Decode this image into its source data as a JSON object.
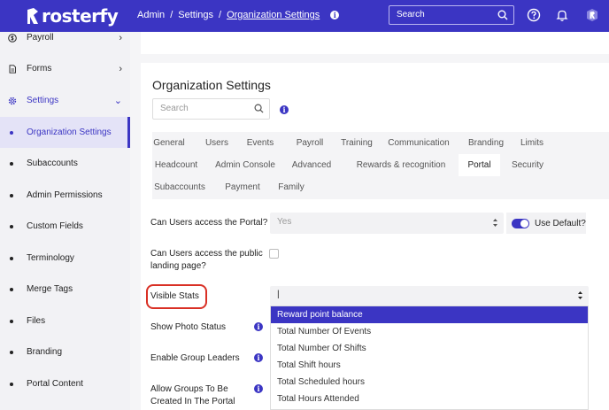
{
  "app": {
    "brand": "rosterfy"
  },
  "header": {
    "breadcrumbs": [
      "Admin",
      "Settings",
      "Organization Settings"
    ],
    "info_glyph": "i",
    "search_placeholder": "Search",
    "icons": [
      "help-circle-icon",
      "bell-icon",
      "user-avatar-icon"
    ]
  },
  "sidebar": {
    "items": [
      {
        "label": "Payroll",
        "icon": "dollar-circle-icon",
        "chevron": "›"
      },
      {
        "label": "Forms",
        "icon": "document-icon",
        "chevron": "›"
      },
      {
        "label": "Settings",
        "icon": "gear-icon",
        "chevron": "⌄"
      },
      {
        "label": "Organization Settings"
      },
      {
        "label": "Subaccounts"
      },
      {
        "label": "Admin Permissions"
      },
      {
        "label": "Custom Fields"
      },
      {
        "label": "Terminology"
      },
      {
        "label": "Merge Tags"
      },
      {
        "label": "Files"
      },
      {
        "label": "Branding"
      },
      {
        "label": "Portal Content"
      }
    ]
  },
  "main": {
    "title": "Organization Settings",
    "search_placeholder": "Search",
    "tabs": [
      "General",
      "Users",
      "Events",
      "Payroll",
      "Training",
      "Communication",
      "Branding",
      "Limits",
      "Headcount",
      "Admin Console",
      "Advanced",
      "Rewards & recognition",
      "Portal",
      "Security",
      "Subaccounts",
      "Payment",
      "Family"
    ],
    "active_tab": "Portal",
    "fields": {
      "portal_access": {
        "label": "Can Users access the Portal?",
        "value": "Yes",
        "use_default_label": "Use Default?",
        "use_default_on": true
      },
      "public_landing": {
        "label_line1": "Can Users access the public",
        "label_line2": "landing page?",
        "checked": false
      },
      "visible_stats": {
        "label": "Visible Stats",
        "value": "|"
      },
      "show_photo": {
        "label": "Show Photo Status"
      },
      "group_leaders": {
        "label": "Enable Group Leaders"
      },
      "allow_groups": {
        "label_line1": "Allow Groups To Be",
        "label_line2": "Created In The Portal"
      }
    },
    "dropdown": {
      "options": [
        "Reward point balance",
        "Total Number Of Events",
        "Total Number Of Shifts",
        "Total Shift hours",
        "Total Scheduled hours",
        "Total Hours Attended"
      ],
      "highlighted": "Reward point balance"
    }
  },
  "colors": {
    "brand": "#3b35c3",
    "highlight_ring": "#d93025"
  }
}
